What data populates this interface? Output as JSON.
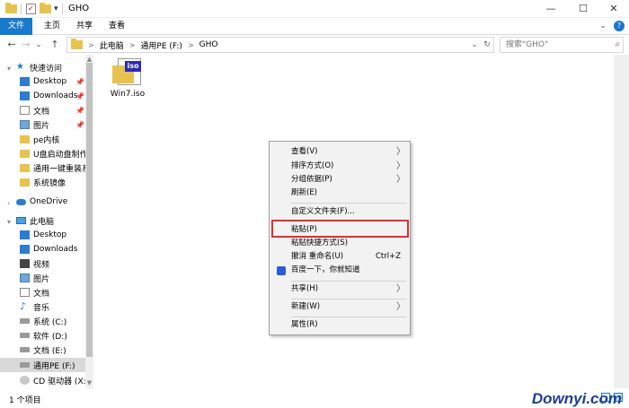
{
  "window": {
    "title": "GHO",
    "minimize": "—",
    "maximize": "☐",
    "close": "✕"
  },
  "ribbon": {
    "tabs": [
      "文件",
      "主页",
      "共享",
      "查看"
    ],
    "expand": "⌄",
    "help": "?",
    "accent": "#1979ca"
  },
  "address": {
    "back": "←",
    "forward": "→",
    "recent": "⌄",
    "up": "↑",
    "breadcrumbs": [
      "此电脑",
      "通用PE (F:)",
      "GHO"
    ],
    "separator": ">",
    "dropdown": "⌄",
    "refresh": "↻",
    "search_placeholder": "搜索\"GHO\""
  },
  "sidebar": {
    "quick_access": "快速访问",
    "quick_items": [
      "Desktop",
      "Downloads",
      "文档",
      "图片",
      "pe内核",
      "U盘启动盘制作…",
      "通用一键重装系…",
      "系统镜像"
    ],
    "onedrive": "OneDrive",
    "this_pc": "此电脑",
    "pc_items": [
      "Desktop",
      "Downloads",
      "视频",
      "图片",
      "文档",
      "音乐",
      "系统 (C:)",
      "软件 (D:)",
      "文档 (E:)",
      "通用PE (F:)",
      "CD 驱动器 (X:)"
    ]
  },
  "content": {
    "file_name": "Win7.iso",
    "file_badge": "iso"
  },
  "context_menu": {
    "view": "查看(V)",
    "sort": "排序方式(O)",
    "group": "分组依据(P)",
    "refresh": "刷新(E)",
    "customize": "自定义文件夹(F)...",
    "paste": "粘贴(P)",
    "paste_shortcut": "粘贴快捷方式(S)",
    "undo_rename": "撤消 重命名(U)",
    "undo_shortcut": "Ctrl+Z",
    "baidu": "百度一下，你就知道",
    "share": "共享(H)",
    "new": "新建(W)",
    "properties": "属性(R)",
    "submenu_arrow": "〉",
    "highlight_color": "#e03030"
  },
  "status": {
    "count": "1 个项目"
  },
  "watermark": "Downyi.com"
}
